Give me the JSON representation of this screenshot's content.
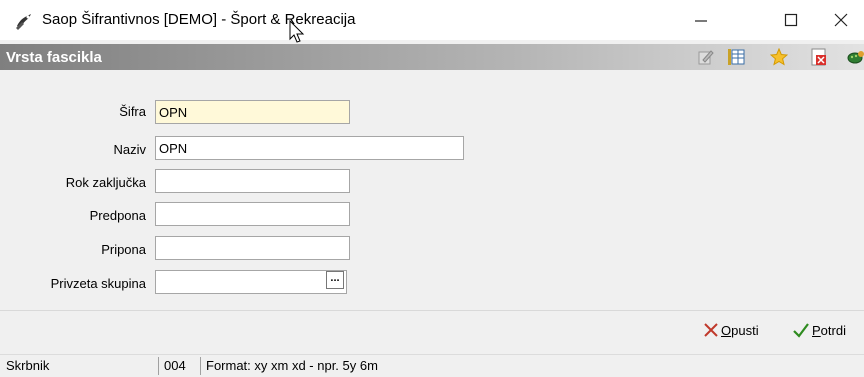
{
  "window": {
    "title": "Saop Šifrantivnos [DEMO] - Šport & Rekreacija",
    "controls": [
      "minimize-icon",
      "maximize-icon",
      "close-icon"
    ]
  },
  "panel": {
    "title": "Vrsta fascikla",
    "toolbar_icons": [
      "edit-icon",
      "table-icon",
      "favorite-star-icon",
      "delete-icon",
      "turtle-icon"
    ]
  },
  "form": {
    "sifra": {
      "label": "Šifra",
      "value": "OPN"
    },
    "naziv": {
      "label": "Naziv",
      "value": "OPN"
    },
    "rok": {
      "label": "Rok zaključka",
      "value": ""
    },
    "predpona": {
      "label": "Predpona",
      "value": ""
    },
    "pripona": {
      "label": "Pripona",
      "value": ""
    },
    "skupina": {
      "label": "Privzeta skupina",
      "value": "",
      "button": "..."
    }
  },
  "actions": {
    "cancel": {
      "accel": "O",
      "rest": "pusti"
    },
    "confirm": {
      "accel": "P",
      "rest": "otrdi"
    }
  },
  "status": {
    "field_name": "Skrbnik",
    "code": "004",
    "hint": "Format: xy xm xd - npr. 5y 6m"
  },
  "colors": {
    "highlight_field": "#fff9d9",
    "cancel_x": "#c0392b",
    "confirm_check": "#2e8b1f"
  }
}
